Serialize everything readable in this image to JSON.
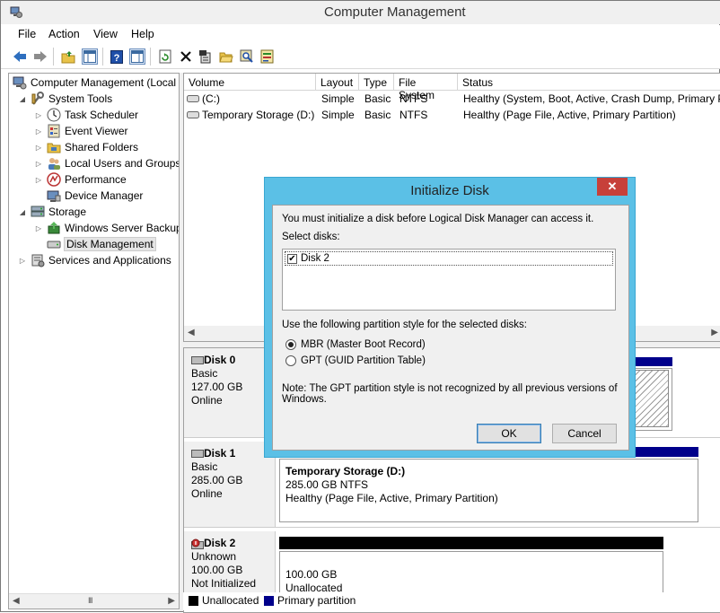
{
  "window": {
    "title": "Computer Management"
  },
  "menu": [
    "File",
    "Action",
    "View",
    "Help"
  ],
  "toolbar": {
    "icons": [
      "back-arrow-icon",
      "forward-arrow-icon",
      "up-folder-icon",
      "show-hide-tree-icon",
      "help-icon",
      "properties-pane-icon",
      "refresh-icon",
      "delete-icon",
      "properties-icon",
      "open-icon",
      "search-icon",
      "export-icon"
    ]
  },
  "tree": {
    "items": [
      {
        "label": "Computer Management (Local",
        "icon": "computer-icon"
      },
      {
        "label": "System Tools",
        "icon": "tools-icon"
      },
      {
        "label": "Task Scheduler",
        "icon": "clock-icon"
      },
      {
        "label": "Event Viewer",
        "icon": "event-viewer-icon"
      },
      {
        "label": "Shared Folders",
        "icon": "shared-folder-icon"
      },
      {
        "label": "Local Users and Groups",
        "icon": "users-icon"
      },
      {
        "label": "Performance",
        "icon": "performance-icon"
      },
      {
        "label": "Device Manager",
        "icon": "device-manager-icon"
      },
      {
        "label": "Storage",
        "icon": "storage-icon"
      },
      {
        "label": "Windows Server Backup",
        "icon": "backup-icon"
      },
      {
        "label": "Disk Management",
        "icon": "disk-icon"
      },
      {
        "label": "Services and Applications",
        "icon": "services-icon"
      }
    ],
    "scroll_grip": "III"
  },
  "volumes": {
    "columns": [
      "Volume",
      "Layout",
      "Type",
      "File System",
      "Status"
    ],
    "rows": [
      {
        "volume": "(C:)",
        "layout": "Simple",
        "type": "Basic",
        "fs": "NTFS",
        "status": "Healthy (System, Boot, Active, Crash Dump, Primary P"
      },
      {
        "volume": "Temporary Storage (D:)",
        "layout": "Simple",
        "type": "Basic",
        "fs": "NTFS",
        "status": "Healthy (Page File, Active, Primary Partition)"
      }
    ]
  },
  "disks": [
    {
      "name": "Disk 0",
      "type": "Basic",
      "size": "127.00 GB",
      "state": "Online"
    },
    {
      "name": "Disk 1",
      "type": "Basic",
      "size": "285.00 GB",
      "state": "Online",
      "partition": {
        "title": "Temporary Storage  (D:)",
        "size": "285.00 GB NTFS",
        "status": "Healthy (Page File, Active, Primary Partition)"
      }
    },
    {
      "name": "Disk 2",
      "type": "Unknown",
      "size": "100.00 GB",
      "state": "Not Initialized",
      "partition": {
        "size": "100.00 GB",
        "status": "Unallocated"
      }
    }
  ],
  "legend": [
    {
      "label": "Unallocated",
      "color": "#000000"
    },
    {
      "label": "Primary partition",
      "color": "#00008b"
    }
  ],
  "dialog": {
    "title": "Initialize Disk",
    "close": "✕",
    "intro": "You must initialize a disk before Logical Disk Manager can access it.",
    "select_label": "Select disks:",
    "disk_item": "Disk 2",
    "disk_checked": true,
    "partition_label": "Use the following partition style for the selected disks:",
    "mbr": "MBR (Master Boot Record)",
    "gpt": "GPT (GUID Partition Table)",
    "selected_style": "MBR",
    "note_line1": "Note: The GPT partition style is not recognized by all previous versions of",
    "note_line2": "Windows.",
    "ok": "OK",
    "cancel": "Cancel"
  }
}
